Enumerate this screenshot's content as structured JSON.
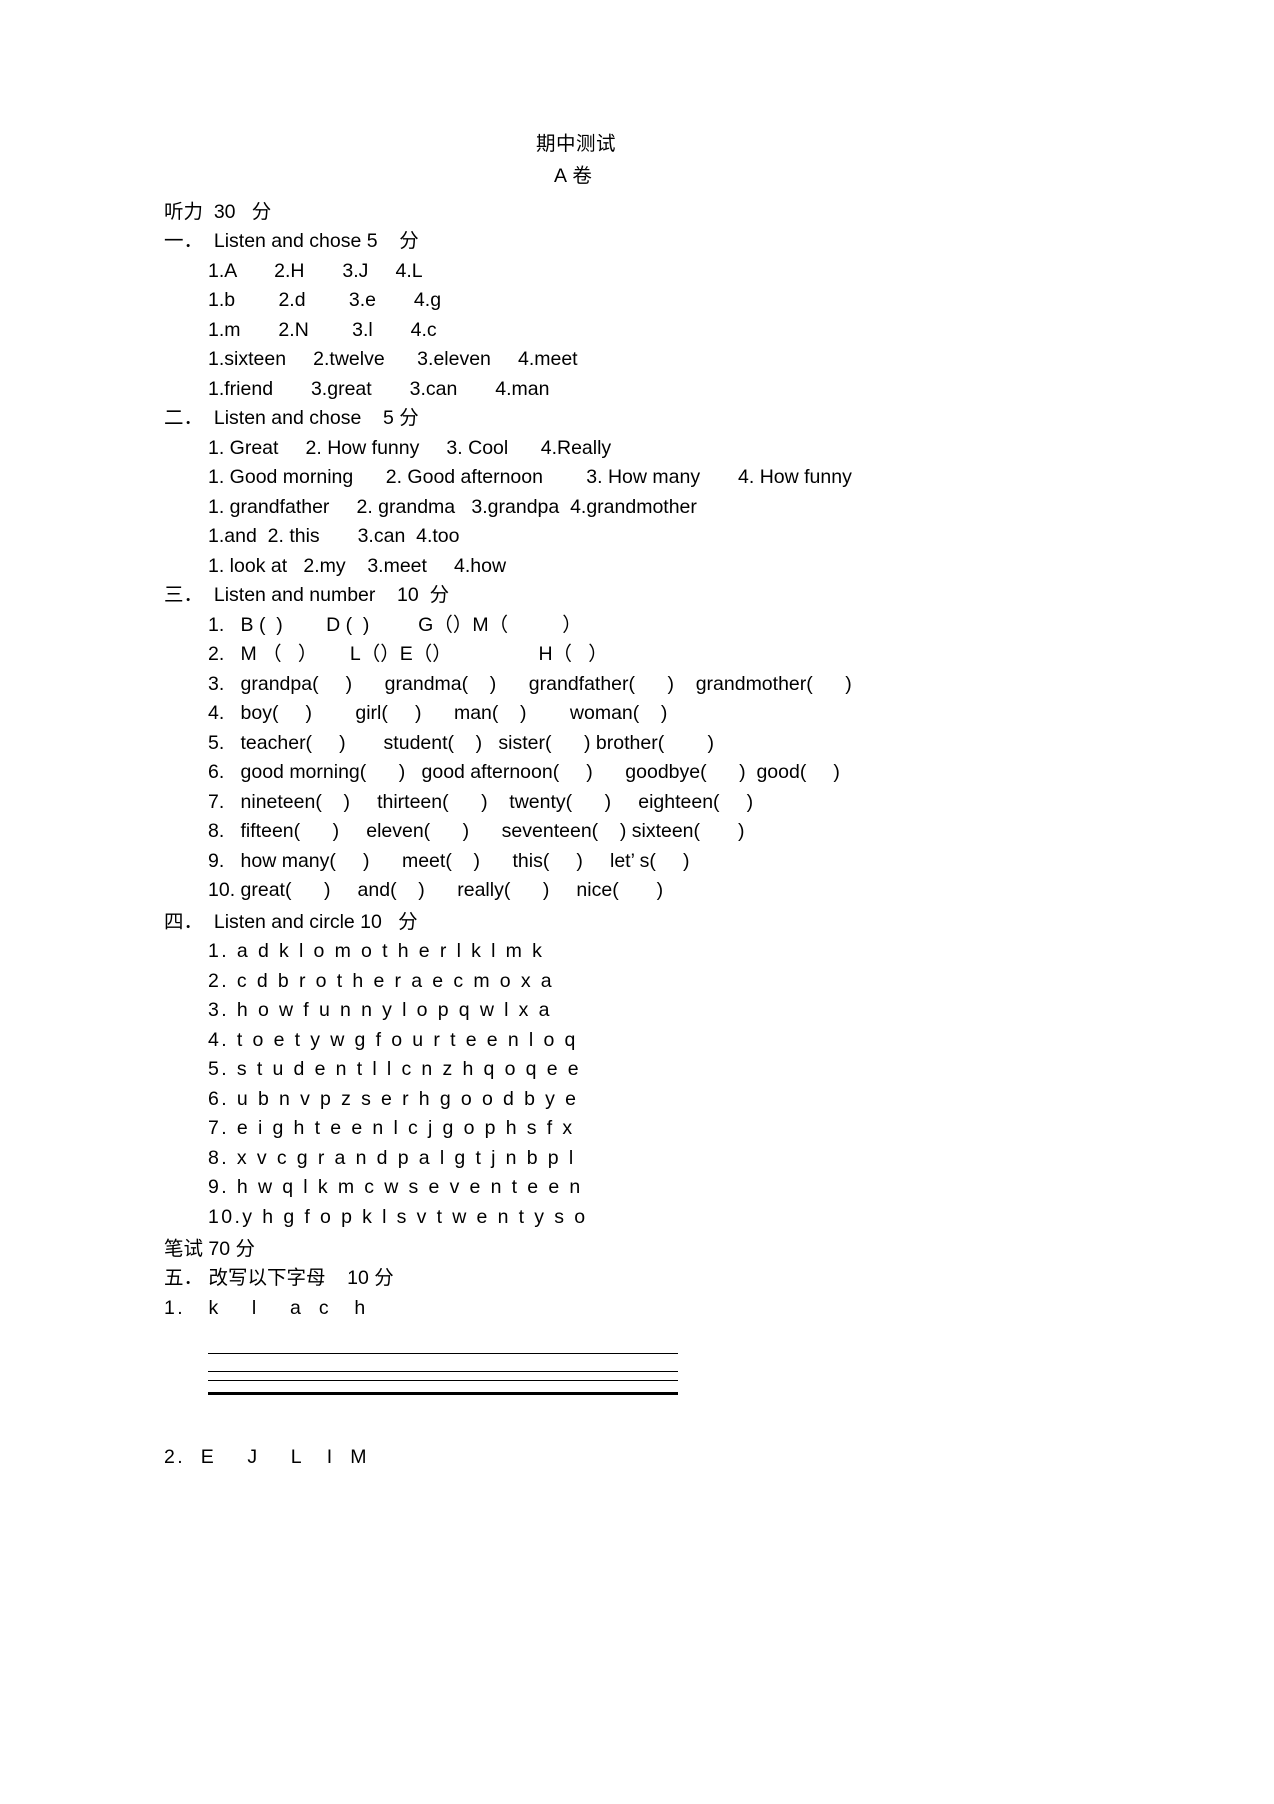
{
  "document": {
    "title": "期中测试",
    "subtitle": "A 卷"
  },
  "listening": {
    "heading": "听力  30   分",
    "sections": [
      {
        "number": "一．",
        "title": "Listen and chose 5    分",
        "lines": [
          "1.A       2.H       3.J     4.L",
          "1.b        2.d        3.e       4.g",
          "1.m       2.N        3.l       4.c",
          "1.sixteen     2.twelve      3.eleven     4.meet",
          "1.friend       3.great       3.can       4.man"
        ]
      },
      {
        "number": "二．",
        "title": "Listen and chose    5 分",
        "lines": [
          "1. Great     2. How funny     3. Cool      4.Really",
          "1. Good morning      2. Good afternoon        3. How many       4. How funny",
          "1. grandfather     2. grandma   3.grandpa  4.grandmother",
          "1.and  2. this       3.can  4.too",
          "1. look at   2.my    3.meet     4.how"
        ]
      },
      {
        "number": "三．",
        "title": "Listen and number    10  分",
        "lines": [
          "1.   B (  )        D (  )         G（）M（          ）",
          "2.   M （   ）      L（）E（）                H（   ）",
          "3.   grandpa(     )      grandma(    )      grandfather(      )    grandmother(      )",
          "4.   boy(     )        girl(     )      man(    )        woman(    )",
          "5.   teacher(     )       student(    )   sister(      ) brother(        )",
          "6.   good morning(      )   good afternoon(     )      goodbye(      )  good(     )",
          "7.   nineteen(    )     thirteen(      )    twenty(      )     eighteen(     )",
          "8.   fifteen(      )     eleven(      )      seventeen(    ) sixteen(       )",
          "9.   how many(     )      meet(    )      this(     )     let’ s(     )",
          "10. great(      )     and(    )      really(      )     nice(       )"
        ]
      },
      {
        "number": "四．",
        "title": "Listen and circle 10   分",
        "lines": [
          "1. a d k l o m o t h e r l k l m k",
          "2. c d b r o t h e r a e c m o x a",
          "3. h o w f u n n y l o p q w l x a",
          "4. t o e t y w g f o u r t e e n l o q",
          "5. s t u d e n t l l c n z h q o q e e",
          "6. u b n v p z s e r h g o o d b y e",
          "7. e i g h t e e n l c j g o p h s f x",
          "8. x v c g r a n d p a l g t j n b p l",
          "9. h w q l k m c w s e v e n t e e n",
          "10.y h g f o p k l s v t w e n t y s o"
        ]
      }
    ]
  },
  "written": {
    "heading": "笔试 70 分",
    "sections": [
      {
        "number": "五．",
        "title": "改写以下字母    10 分",
        "items": [
          "1.   k    l    a  c   h",
          "2.  E    J    L   I  M"
        ]
      }
    ]
  }
}
